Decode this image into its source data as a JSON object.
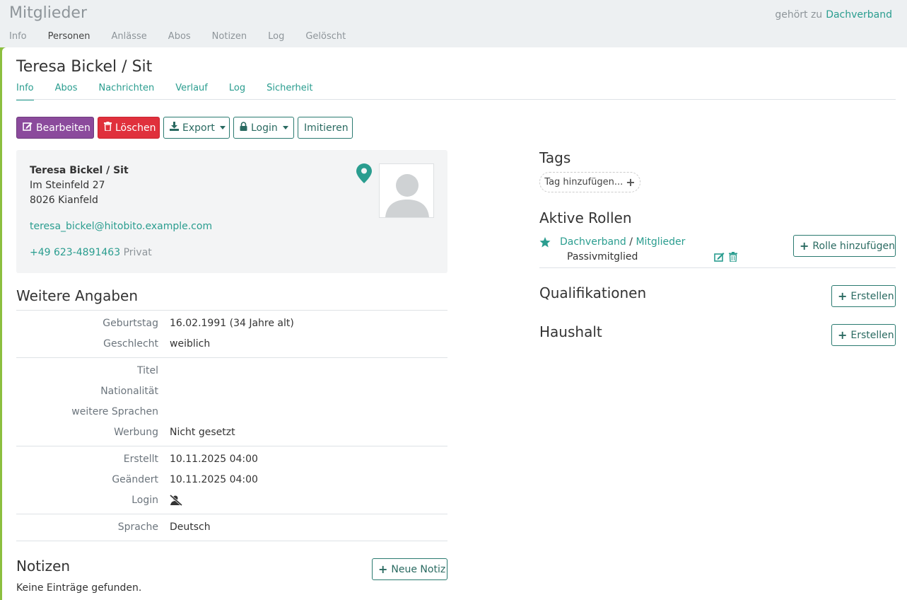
{
  "topbar": {
    "title": "Mitglieder",
    "belongs_label": "gehört zu",
    "belongs_link": "Dachverband",
    "nav": [
      "Info",
      "Personen",
      "Anlässe",
      "Abos",
      "Notizen",
      "Log",
      "Gelöscht"
    ],
    "nav_active": "Personen"
  },
  "person": {
    "title": "Teresa Bickel / Sit",
    "tabs": [
      "Info",
      "Abos",
      "Nachrichten",
      "Verlauf",
      "Log",
      "Sicherheit"
    ],
    "tab_active": "Info"
  },
  "actions": {
    "edit": "Bearbeiten",
    "delete": "Löschen",
    "export": "Export",
    "login": "Login",
    "impersonate": "Imitieren"
  },
  "contact": {
    "name": "Teresa Bickel / Sit",
    "street": "Im Steinfeld 27",
    "city": "8026 Kianfeld",
    "email": "teresa_bickel@hitobito.example.com",
    "phone": "+49 623-4891463",
    "phone_label": "Privat"
  },
  "details": {
    "heading": "Weitere Angaben",
    "birthday_label": "Geburtstag",
    "birthday": "16.02.1991 (34 Jahre alt)",
    "gender_label": "Geschlecht",
    "gender": "weiblich",
    "title_label": "Titel",
    "nationality_label": "Nationalität",
    "languages_label": "weitere Sprachen",
    "ads_label": "Werbung",
    "ads": "Nicht gesetzt",
    "created_label": "Erstellt",
    "created": "10.11.2025 04:00",
    "updated_label": "Geändert",
    "updated": "10.11.2025 04:00",
    "login_label": "Login",
    "language_label": "Sprache",
    "language": "Deutsch"
  },
  "notes": {
    "heading": "Notizen",
    "new_button": "Neue Notiz",
    "empty": "Keine Einträge gefunden."
  },
  "tags": {
    "heading": "Tags",
    "add": "Tag hinzufügen..."
  },
  "roles": {
    "heading": "Aktive Rollen",
    "group": "Dachverband",
    "separator": "/",
    "subgroup": "Mitglieder",
    "role": "Passivmitglied",
    "add_button": "Rolle hinzufügen"
  },
  "qualifications": {
    "heading": "Qualifikationen",
    "create_button": "Erstellen"
  },
  "household": {
    "heading": "Haushalt",
    "create_button": "Erstellen"
  },
  "colors": {
    "accent": "#2a9d8f",
    "edit_button": "#8b4a9c",
    "delete_button": "#e0303c",
    "page_border": "#8cbf3f"
  }
}
